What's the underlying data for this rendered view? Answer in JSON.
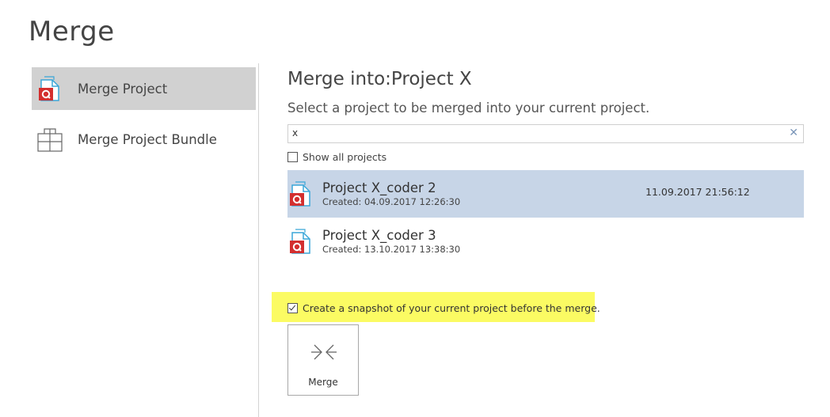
{
  "page": {
    "title": "Merge"
  },
  "sidebar": {
    "items": [
      {
        "label": "Merge Project",
        "icon": "project-file-icon",
        "selected": true
      },
      {
        "label": "Merge Project Bundle",
        "icon": "bundle-icon",
        "selected": false
      }
    ]
  },
  "main": {
    "heading": "Merge into:Project X",
    "subheading": "Select a project to be merged into your current project.",
    "search": {
      "value": "x",
      "placeholder": "",
      "clear_symbol": "✕"
    },
    "show_all": {
      "label": "Show all projects",
      "checked": false
    },
    "projects": [
      {
        "name": "Project X_coder 2",
        "created": "Created:  04.09.2017 12:26:30",
        "modified": "11.09.2017 21:56:12",
        "selected": true
      },
      {
        "name": "Project X_coder 3",
        "created": "Created:  13.10.2017 13:38:30",
        "modified": "",
        "selected": false
      }
    ],
    "snapshot": {
      "label": "Create a snapshot of your current project before the merge.",
      "checked": true
    },
    "merge_button": {
      "label": "Merge",
      "icon": "merge-arrows-icon"
    }
  },
  "colors": {
    "selected_nav": "#d1d1d1",
    "selected_project": "#c7d5e7",
    "highlight": "#fbfb63",
    "icon_red": "#d32f2f",
    "icon_blue": "#3aa6d8"
  }
}
